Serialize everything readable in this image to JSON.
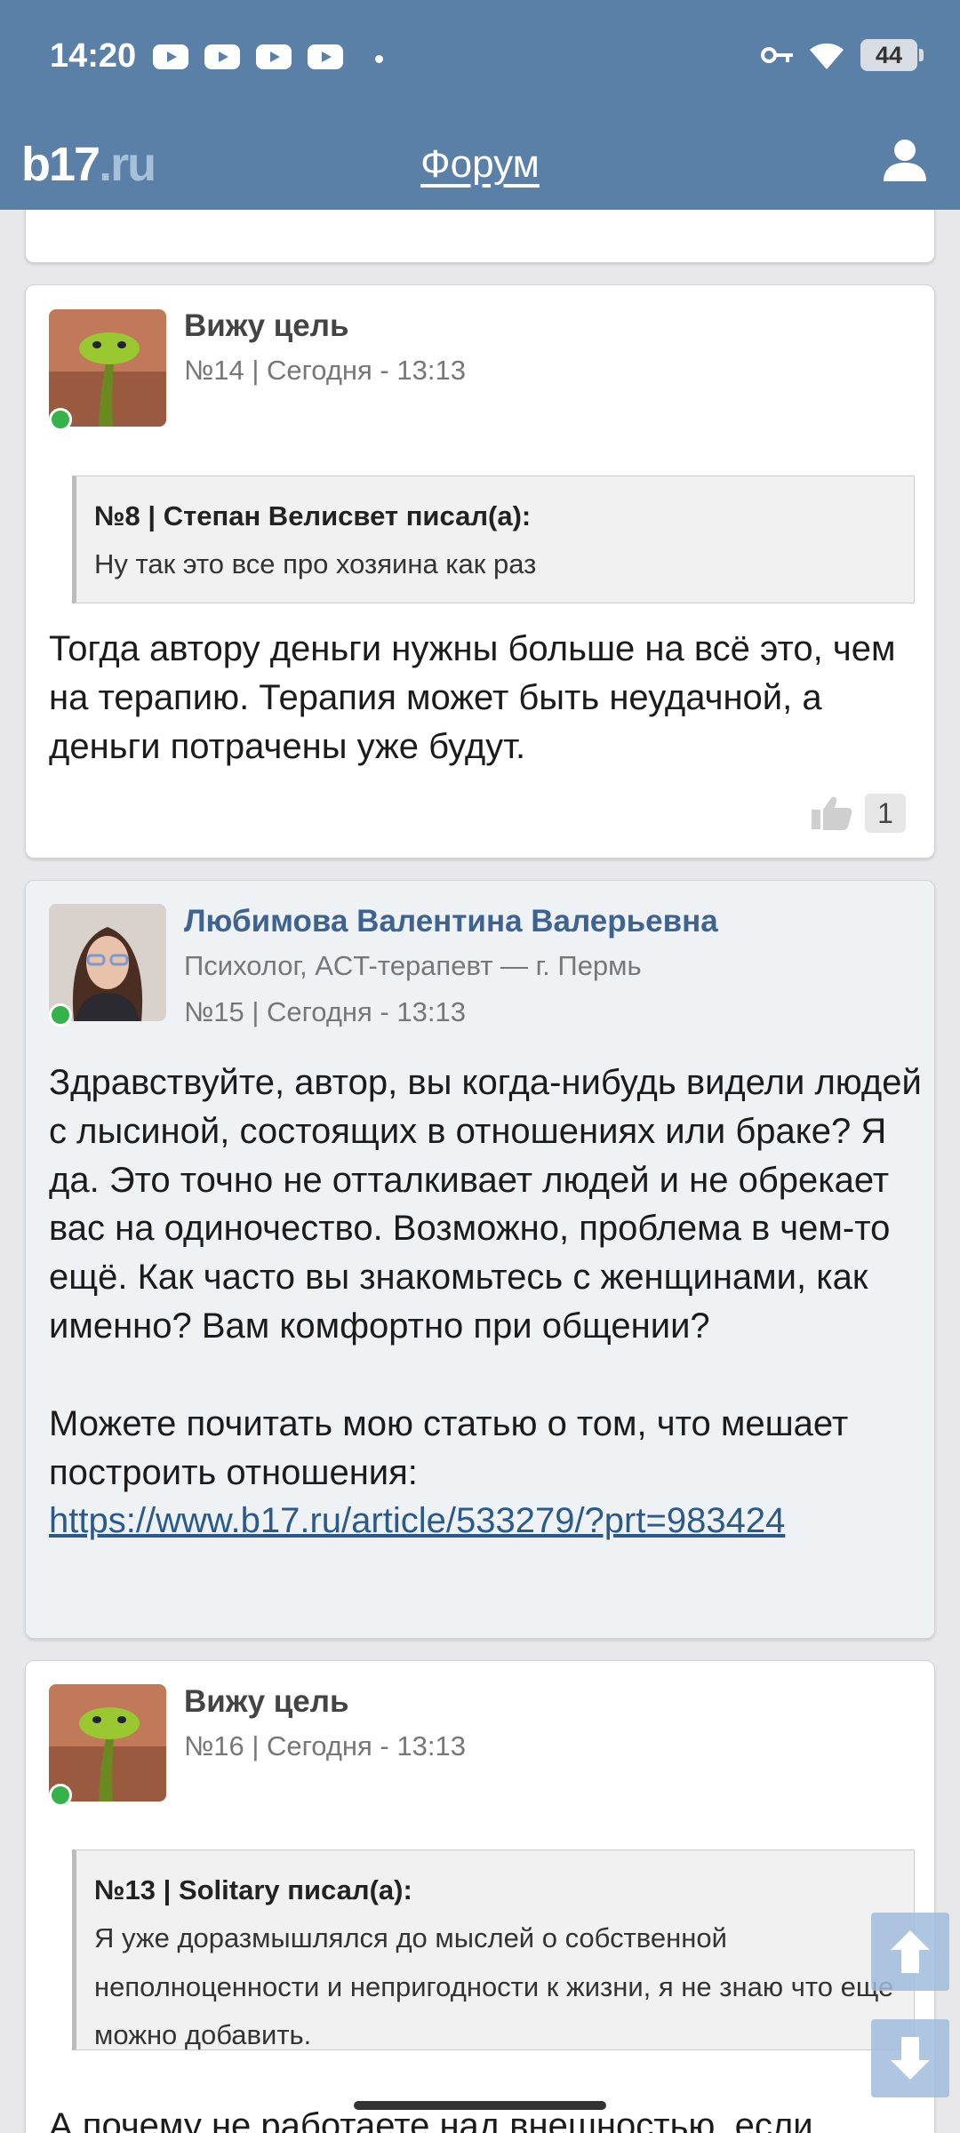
{
  "status_bar": {
    "time": "14:20",
    "battery": "44"
  },
  "header": {
    "logo_main": "b17",
    "logo_suffix": ".ru",
    "title": "Форум"
  },
  "posts": [
    {
      "author": "Вижу цель",
      "meta": "№14 | Сегодня - 13:13",
      "quote_head": "№8 | Степан Велисвет писал(а):",
      "quote_text": "Ну так это все про хозяина как раз",
      "text": "Тогда автору деньги нужны больше на всё это, чем на терапию. Терапия может быть неудачной, а деньги потрачены уже будут.",
      "likes": "1"
    },
    {
      "author": "Любимова Валентина Валерьевна",
      "role": "Психолог, ACT-терапевт — г. Пермь",
      "meta": "№15 | Сегодня - 13:13",
      "text_p1": "Здравствуйте, автор, вы когда-нибудь видели людей с лысиной, состоящих в отношениях или браке? Я да. Это точно не отталкивает людей и не обрекает вас на одиночество. Возможно, проблема в чем-то ещё. Как часто вы знакомьтесь с женщинами, как именно? Вам комфортно при общении?",
      "text_p2": "Можете почитать мою статью о том, что мешает построить отношения:",
      "link": "https://www.b17.ru/article/533279/?prt=983424"
    },
    {
      "author": "Вижу цель",
      "meta": "№16 | Сегодня - 13:13",
      "quote_head": "№13 | Solitary писал(а):",
      "quote_text": "Я уже доразмышлялся до мыслей о собственной неполноценности и непригодности к жизни, я не знаю что еще можно добавить.",
      "text": "А почему не работаете над внешностью, если"
    }
  ],
  "colors": {
    "header_bg": "#5a80a8",
    "online": "#34b34a",
    "link": "#2a5a8c"
  }
}
